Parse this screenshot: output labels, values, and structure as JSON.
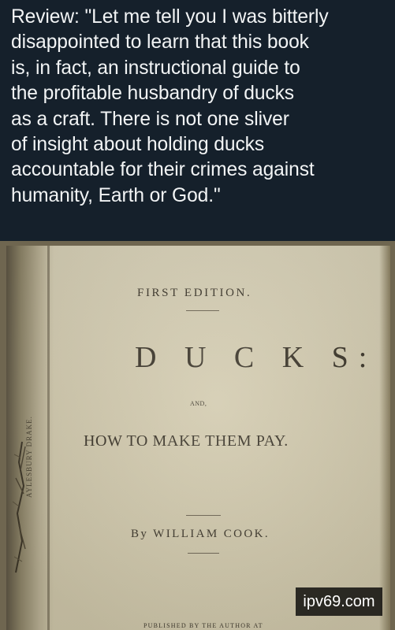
{
  "post": {
    "review_text": "Review: \"Let me tell you I was bitterly\ndisappointed to learn that this book\nis, in fact, an instructional guide to\nthe profitable husbandry of ducks\nas a craft. There is not one sliver\nof insight about holding ducks\naccountable for their crimes against\nhumanity, Earth or God.\""
  },
  "book_page": {
    "edition": "FIRST EDITION.",
    "title": "D U C K S:",
    "conjunction": "AND,",
    "subtitle": "HOW TO MAKE THEM PAY.",
    "author": "By WILLIAM COOK.",
    "publisher_line": "PUBLISHED BY THE AUTHOR AT",
    "side_label": "AYLESBURY DRAKE."
  },
  "watermark": {
    "text": "ipv69.com"
  },
  "colors": {
    "background": "#15202b",
    "text": "#f2f4f5",
    "paper": "#d2caae",
    "ink": "#3a3428"
  }
}
